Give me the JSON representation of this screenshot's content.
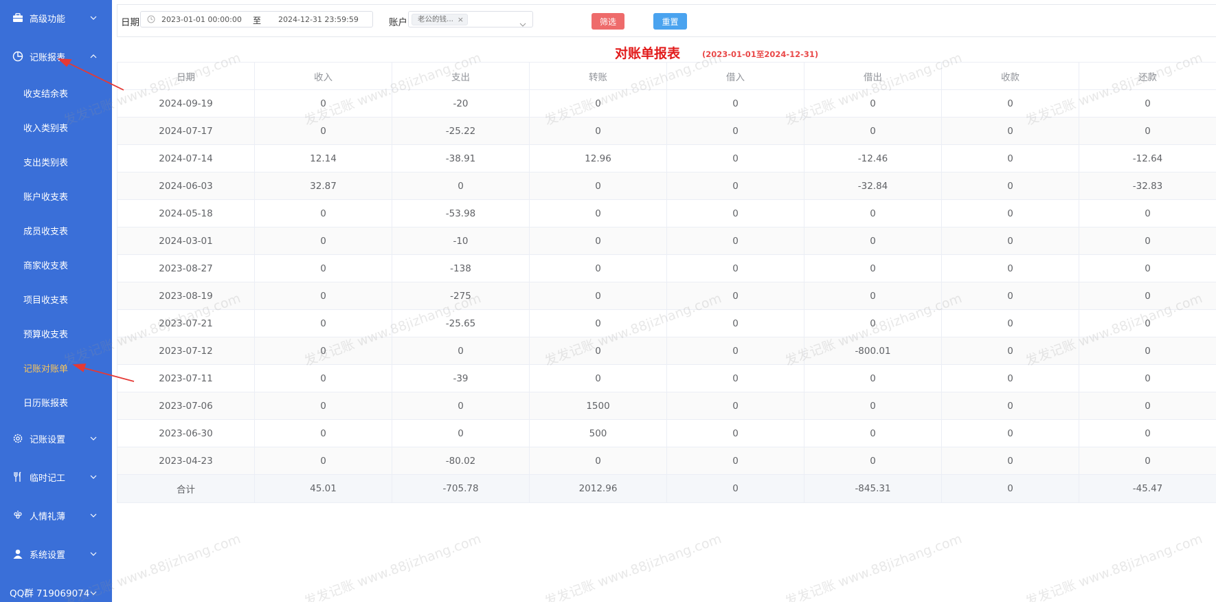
{
  "sidebar": {
    "groups": [
      {
        "label": "高级功能",
        "icon": "briefcase-icon"
      },
      {
        "label": "记账报表",
        "icon": "pie-chart-icon"
      },
      {
        "label": "记账设置",
        "icon": "gear-icon"
      },
      {
        "label": "临时记工",
        "icon": "fork-knife-icon"
      },
      {
        "label": "人情礼薄",
        "icon": "grapes-icon"
      },
      {
        "label": "系统设置",
        "icon": "user-icon"
      }
    ],
    "report_items": [
      "收支结余表",
      "收入类别表",
      "支出类别表",
      "账户收支表",
      "成员收支表",
      "商家收支表",
      "项目收支表",
      "预算收支表",
      "记账对账单",
      "日历账报表"
    ],
    "active_item": "记账对账单",
    "qq_label": "QQ群 719069074"
  },
  "filter": {
    "date_label": "日期",
    "start": "2023-01-01 00:00:00",
    "separator": "至",
    "end": "2024-12-31 23:59:59",
    "account_label": "账户",
    "account_tag": "老公的钱...",
    "filter_button": "筛选",
    "reset_button": "重置"
  },
  "report": {
    "title": "对账单报表",
    "range": "(2023-01-01至2024-12-31)",
    "columns": [
      "日期",
      "收入",
      "支出",
      "转账",
      "借入",
      "借出",
      "收款",
      "还款"
    ],
    "rows": [
      [
        "2024-09-19",
        "0",
        "-20",
        "0",
        "0",
        "0",
        "0",
        "0"
      ],
      [
        "2024-07-17",
        "0",
        "-25.22",
        "0",
        "0",
        "0",
        "0",
        "0"
      ],
      [
        "2024-07-14",
        "12.14",
        "-38.91",
        "12.96",
        "0",
        "-12.46",
        "0",
        "-12.64"
      ],
      [
        "2024-06-03",
        "32.87",
        "0",
        "0",
        "0",
        "-32.84",
        "0",
        "-32.83"
      ],
      [
        "2024-05-18",
        "0",
        "-53.98",
        "0",
        "0",
        "0",
        "0",
        "0"
      ],
      [
        "2024-03-01",
        "0",
        "-10",
        "0",
        "0",
        "0",
        "0",
        "0"
      ],
      [
        "2023-08-27",
        "0",
        "-138",
        "0",
        "0",
        "0",
        "0",
        "0"
      ],
      [
        "2023-08-19",
        "0",
        "-275",
        "0",
        "0",
        "0",
        "0",
        "0"
      ],
      [
        "2023-07-21",
        "0",
        "-25.65",
        "0",
        "0",
        "0",
        "0",
        "0"
      ],
      [
        "2023-07-12",
        "0",
        "0",
        "0",
        "0",
        "-800.01",
        "0",
        "0"
      ],
      [
        "2023-07-11",
        "0",
        "-39",
        "0",
        "0",
        "0",
        "0",
        "0"
      ],
      [
        "2023-07-06",
        "0",
        "0",
        "1500",
        "0",
        "0",
        "0",
        "0"
      ],
      [
        "2023-06-30",
        "0",
        "0",
        "500",
        "0",
        "0",
        "0",
        "0"
      ],
      [
        "2023-04-23",
        "0",
        "-80.02",
        "0",
        "0",
        "0",
        "0",
        "0"
      ]
    ],
    "total": [
      "合计",
      "45.01",
      "-705.78",
      "2012.96",
      "0",
      "-845.31",
      "0",
      "-45.47"
    ]
  },
  "watermark": "发发记账 www.88jizhang.com",
  "colors": {
    "sidebar_bg": "#3a6fd8",
    "active_item": "#f7c55c",
    "title_red": "#e21b1b",
    "filter_button": "#ee6b6b",
    "reset_button": "#4aa3ef",
    "annotation_arrow": "#e53935"
  }
}
